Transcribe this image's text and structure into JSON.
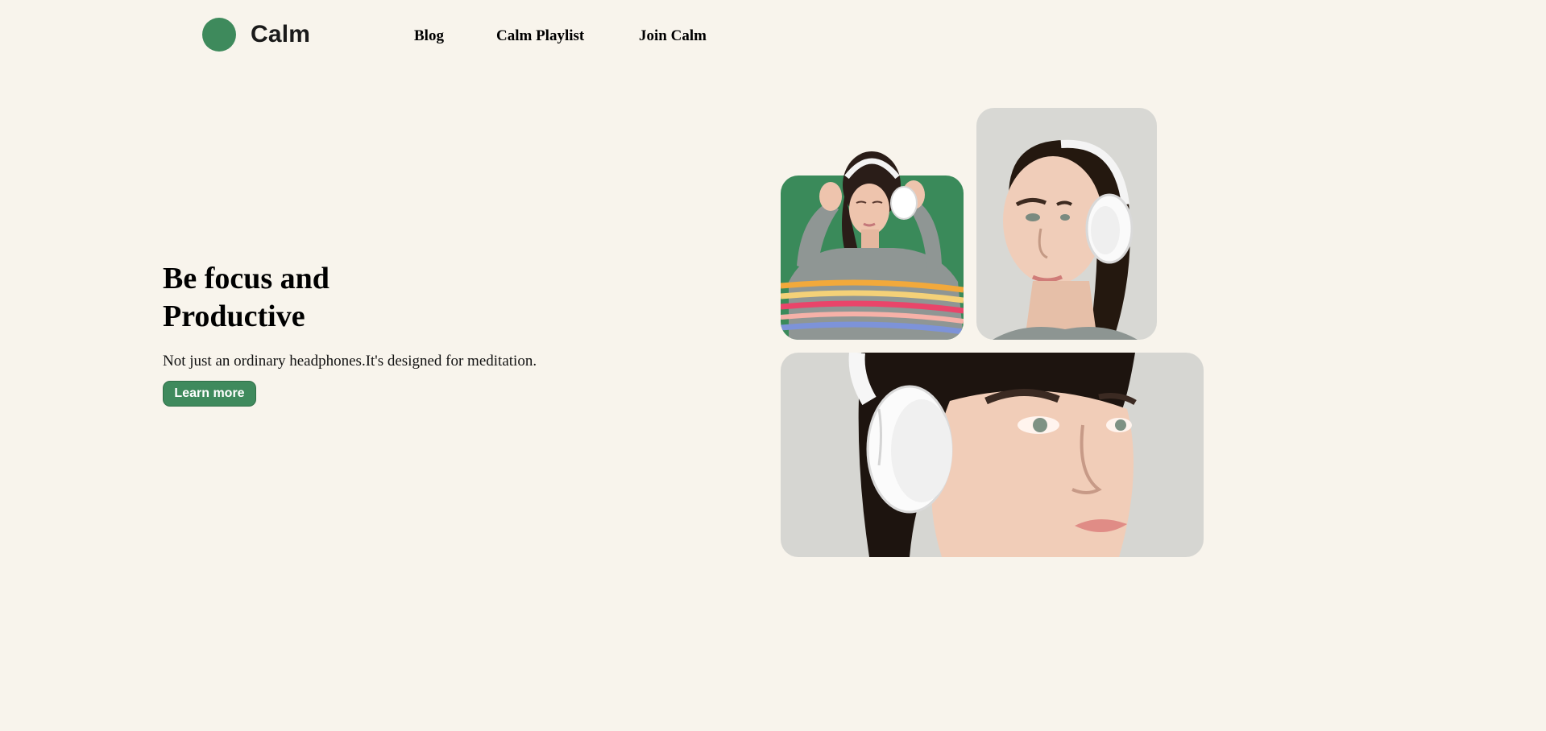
{
  "brand": {
    "name": "Calm",
    "color": "#3e8a5c",
    "logo_icon": "green-circle-logo-icon"
  },
  "nav": {
    "items": [
      "Blog",
      "Calm Playlist",
      "Join Calm"
    ]
  },
  "hero": {
    "title_line1": "Be focus and",
    "title_line2": "Productive",
    "subtitle": "Not just an ordinary headphones.It's designed for meditation.",
    "cta_label": "Learn more"
  },
  "colors": {
    "background": "#f8f4ec",
    "accent": "#3f8a5d"
  }
}
